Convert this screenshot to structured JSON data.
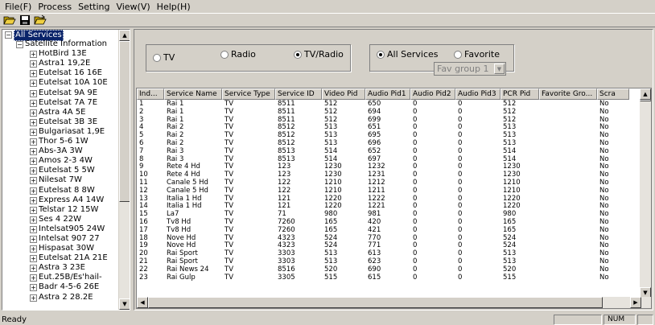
{
  "menu": {
    "items": [
      "File(F)",
      "Process",
      "Setting",
      "View(V)",
      "Help(H)"
    ]
  },
  "toolbar": {
    "icons": [
      "open-folder-icon",
      "save-disk-icon",
      "open-file-icon"
    ]
  },
  "tree": {
    "root": "All Services",
    "group": "Satellite Information",
    "satellites": [
      "HotBird 13E",
      "Astra1 19,2E",
      "Eutelsat 16 16E",
      "Eutelsat 10A 10E",
      "Eutelsat 9A 9E",
      "Eutelsat 7A 7E",
      "Astra 4A 5E",
      "Eutelsat 3B 3E",
      "Bulgariasat 1,9E",
      "Thor 5-6 1W",
      "Abs-3A 3W",
      "Amos 2-3 4W",
      "Eutelsat 5 5W",
      "Nilesat 7W",
      "Eutelsat 8 8W",
      "Express A4 14W",
      "Telstar 12 15W",
      "Ses 4 22W",
      "Intelsat905 24W",
      "Intelsat 907 27",
      "Hispasat 30W",
      "Eutelsat 21A 21E",
      "Astra 3 23E",
      "Eut.25B/Es'hail-",
      "Badr 4-5-6 26E",
      "Astra 2 28.2E"
    ]
  },
  "filters": {
    "type_options": [
      {
        "label": "TV",
        "selected": false
      },
      {
        "label": "Radio",
        "selected": false
      },
      {
        "label": "TV/Radio",
        "selected": true
      }
    ],
    "scope_options": [
      {
        "label": "All Services",
        "selected": true
      },
      {
        "label": "Favorite",
        "selected": false
      }
    ],
    "fav_group": "Fav group 1"
  },
  "table": {
    "columns": [
      "Ind...",
      "Service Name",
      "Service Type",
      "Service ID",
      "Video Pid",
      "Audio Pid1",
      "Audio Pid2",
      "Audio Pid3",
      "PCR Pid",
      "Favorite Gro...",
      "Scra"
    ],
    "rows": [
      [
        "1",
        "Rai 1",
        "TV",
        "8511",
        "512",
        "650",
        "0",
        "0",
        "512",
        "",
        "No"
      ],
      [
        "2",
        "Rai 1",
        "TV",
        "8511",
        "512",
        "694",
        "0",
        "0",
        "512",
        "",
        "No"
      ],
      [
        "3",
        "Rai 1",
        "TV",
        "8511",
        "512",
        "699",
        "0",
        "0",
        "512",
        "",
        "No"
      ],
      [
        "4",
        "Rai 2",
        "TV",
        "8512",
        "513",
        "651",
        "0",
        "0",
        "513",
        "",
        "No"
      ],
      [
        "5",
        "Rai 2",
        "TV",
        "8512",
        "513",
        "695",
        "0",
        "0",
        "513",
        "",
        "No"
      ],
      [
        "6",
        "Rai 2",
        "TV",
        "8512",
        "513",
        "696",
        "0",
        "0",
        "513",
        "",
        "No"
      ],
      [
        "7",
        "Rai 3",
        "TV",
        "8513",
        "514",
        "652",
        "0",
        "0",
        "514",
        "",
        "No"
      ],
      [
        "8",
        "Rai 3",
        "TV",
        "8513",
        "514",
        "697",
        "0",
        "0",
        "514",
        "",
        "No"
      ],
      [
        "9",
        "Rete 4 Hd",
        "TV",
        "123",
        "1230",
        "1232",
        "0",
        "0",
        "1230",
        "",
        "No"
      ],
      [
        "10",
        "Rete 4 Hd",
        "TV",
        "123",
        "1230",
        "1231",
        "0",
        "0",
        "1230",
        "",
        "No"
      ],
      [
        "11",
        "Canale 5 Hd",
        "TV",
        "122",
        "1210",
        "1212",
        "0",
        "0",
        "1210",
        "",
        "No"
      ],
      [
        "12",
        "Canale 5 Hd",
        "TV",
        "122",
        "1210",
        "1211",
        "0",
        "0",
        "1210",
        "",
        "No"
      ],
      [
        "13",
        "Italia 1 Hd",
        "TV",
        "121",
        "1220",
        "1222",
        "0",
        "0",
        "1220",
        "",
        "No"
      ],
      [
        "14",
        "Italia 1 Hd",
        "TV",
        "121",
        "1220",
        "1221",
        "0",
        "0",
        "1220",
        "",
        "No"
      ],
      [
        "15",
        "La7",
        "TV",
        "71",
        "980",
        "981",
        "0",
        "0",
        "980",
        "",
        "No"
      ],
      [
        "16",
        "Tv8 Hd",
        "TV",
        "7260",
        "165",
        "420",
        "0",
        "0",
        "165",
        "",
        "No"
      ],
      [
        "17",
        "Tv8 Hd",
        "TV",
        "7260",
        "165",
        "421",
        "0",
        "0",
        "165",
        "",
        "No"
      ],
      [
        "18",
        "Nove Hd",
        "TV",
        "4323",
        "524",
        "770",
        "0",
        "0",
        "524",
        "",
        "No"
      ],
      [
        "19",
        "Nove Hd",
        "TV",
        "4323",
        "524",
        "771",
        "0",
        "0",
        "524",
        "",
        "No"
      ],
      [
        "20",
        "Rai Sport",
        "TV",
        "3303",
        "513",
        "613",
        "0",
        "0",
        "513",
        "",
        "No"
      ],
      [
        "21",
        "Rai Sport",
        "TV",
        "3303",
        "513",
        "623",
        "0",
        "0",
        "513",
        "",
        "No"
      ],
      [
        "22",
        "Rai News 24",
        "TV",
        "8516",
        "520",
        "690",
        "0",
        "0",
        "520",
        "",
        "No"
      ],
      [
        "23",
        "Rai Gulp",
        "TV",
        "3305",
        "515",
        "615",
        "0",
        "0",
        "515",
        "",
        "No"
      ]
    ]
  },
  "status": {
    "text": "Ready",
    "num": "NUM"
  }
}
